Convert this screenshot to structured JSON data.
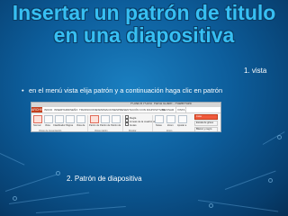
{
  "slide": {
    "title_line1": "Insertar un patrón de titulo",
    "title_line2": "en una diapositiva",
    "callout_vista": "1. vista",
    "bullet_text": "en el menú vista elija patrón y a continuación haga clic en patrón",
    "callout_patron": "2. Patrón de diapositiva"
  },
  "screenshot": {
    "window_title": "POWER POINT PARA SUBIR - PowerPoint",
    "tabs": [
      "ARCHIVO",
      "INICIO",
      "INSERTAR",
      "DISEÑO",
      "TRANSICIONES",
      "ANIMACIONES",
      "PRESENTACIÓN CON DIAPOSITIVAS",
      "REVISAR",
      "VISTA"
    ],
    "ribbon_buttons": [
      "Normal",
      "Vista",
      "Clasificador",
      "Página",
      "Vista de",
      "Patrón de",
      "Patrón de",
      "Patrón de",
      "Regla",
      "Líneas de la cuadrícula",
      "Guías",
      "Notas",
      "Zoom",
      "Ajustar a",
      "la ventana"
    ],
    "group_labels": [
      "Vistas de presentación",
      "Vistas patrón",
      "Mostrar",
      "Zoom"
    ],
    "side_items": [
      "Color",
      "Escala de grises",
      "Blanco y negro"
    ],
    "colors": {
      "accent": "#37bff2",
      "office_red": "#c43e1c"
    }
  }
}
